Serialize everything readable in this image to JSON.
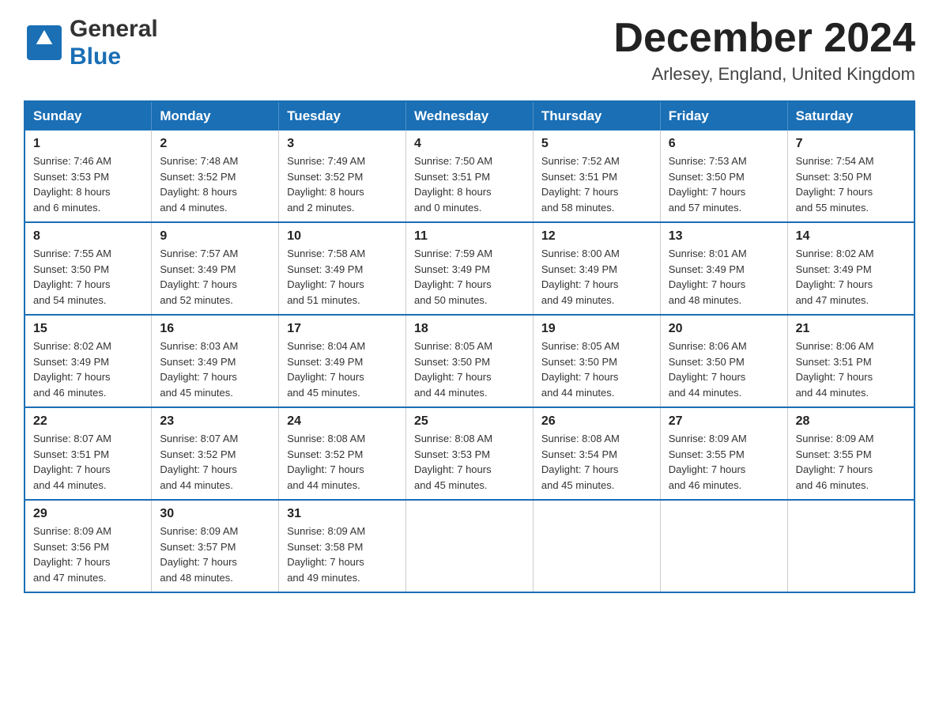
{
  "header": {
    "logo_general": "General",
    "logo_blue": "Blue",
    "title": "December 2024",
    "location": "Arlesey, England, United Kingdom"
  },
  "columns": [
    "Sunday",
    "Monday",
    "Tuesday",
    "Wednesday",
    "Thursday",
    "Friday",
    "Saturday"
  ],
  "weeks": [
    [
      {
        "day": "1",
        "sunrise": "7:46 AM",
        "sunset": "3:53 PM",
        "daylight": "8 hours",
        "minutes": "and 6 minutes."
      },
      {
        "day": "2",
        "sunrise": "7:48 AM",
        "sunset": "3:52 PM",
        "daylight": "8 hours",
        "minutes": "and 4 minutes."
      },
      {
        "day": "3",
        "sunrise": "7:49 AM",
        "sunset": "3:52 PM",
        "daylight": "8 hours",
        "minutes": "and 2 minutes."
      },
      {
        "day": "4",
        "sunrise": "7:50 AM",
        "sunset": "3:51 PM",
        "daylight": "8 hours",
        "minutes": "and 0 minutes."
      },
      {
        "day": "5",
        "sunrise": "7:52 AM",
        "sunset": "3:51 PM",
        "daylight": "7 hours",
        "minutes": "and 58 minutes."
      },
      {
        "day": "6",
        "sunrise": "7:53 AM",
        "sunset": "3:50 PM",
        "daylight": "7 hours",
        "minutes": "and 57 minutes."
      },
      {
        "day": "7",
        "sunrise": "7:54 AM",
        "sunset": "3:50 PM",
        "daylight": "7 hours",
        "minutes": "and 55 minutes."
      }
    ],
    [
      {
        "day": "8",
        "sunrise": "7:55 AM",
        "sunset": "3:50 PM",
        "daylight": "7 hours",
        "minutes": "and 54 minutes."
      },
      {
        "day": "9",
        "sunrise": "7:57 AM",
        "sunset": "3:49 PM",
        "daylight": "7 hours",
        "minutes": "and 52 minutes."
      },
      {
        "day": "10",
        "sunrise": "7:58 AM",
        "sunset": "3:49 PM",
        "daylight": "7 hours",
        "minutes": "and 51 minutes."
      },
      {
        "day": "11",
        "sunrise": "7:59 AM",
        "sunset": "3:49 PM",
        "daylight": "7 hours",
        "minutes": "and 50 minutes."
      },
      {
        "day": "12",
        "sunrise": "8:00 AM",
        "sunset": "3:49 PM",
        "daylight": "7 hours",
        "minutes": "and 49 minutes."
      },
      {
        "day": "13",
        "sunrise": "8:01 AM",
        "sunset": "3:49 PM",
        "daylight": "7 hours",
        "minutes": "and 48 minutes."
      },
      {
        "day": "14",
        "sunrise": "8:02 AM",
        "sunset": "3:49 PM",
        "daylight": "7 hours",
        "minutes": "and 47 minutes."
      }
    ],
    [
      {
        "day": "15",
        "sunrise": "8:02 AM",
        "sunset": "3:49 PM",
        "daylight": "7 hours",
        "minutes": "and 46 minutes."
      },
      {
        "day": "16",
        "sunrise": "8:03 AM",
        "sunset": "3:49 PM",
        "daylight": "7 hours",
        "minutes": "and 45 minutes."
      },
      {
        "day": "17",
        "sunrise": "8:04 AM",
        "sunset": "3:49 PM",
        "daylight": "7 hours",
        "minutes": "and 45 minutes."
      },
      {
        "day": "18",
        "sunrise": "8:05 AM",
        "sunset": "3:50 PM",
        "daylight": "7 hours",
        "minutes": "and 44 minutes."
      },
      {
        "day": "19",
        "sunrise": "8:05 AM",
        "sunset": "3:50 PM",
        "daylight": "7 hours",
        "minutes": "and 44 minutes."
      },
      {
        "day": "20",
        "sunrise": "8:06 AM",
        "sunset": "3:50 PM",
        "daylight": "7 hours",
        "minutes": "and 44 minutes."
      },
      {
        "day": "21",
        "sunrise": "8:06 AM",
        "sunset": "3:51 PM",
        "daylight": "7 hours",
        "minutes": "and 44 minutes."
      }
    ],
    [
      {
        "day": "22",
        "sunrise": "8:07 AM",
        "sunset": "3:51 PM",
        "daylight": "7 hours",
        "minutes": "and 44 minutes."
      },
      {
        "day": "23",
        "sunrise": "8:07 AM",
        "sunset": "3:52 PM",
        "daylight": "7 hours",
        "minutes": "and 44 minutes."
      },
      {
        "day": "24",
        "sunrise": "8:08 AM",
        "sunset": "3:52 PM",
        "daylight": "7 hours",
        "minutes": "and 44 minutes."
      },
      {
        "day": "25",
        "sunrise": "8:08 AM",
        "sunset": "3:53 PM",
        "daylight": "7 hours",
        "minutes": "and 45 minutes."
      },
      {
        "day": "26",
        "sunrise": "8:08 AM",
        "sunset": "3:54 PM",
        "daylight": "7 hours",
        "minutes": "and 45 minutes."
      },
      {
        "day": "27",
        "sunrise": "8:09 AM",
        "sunset": "3:55 PM",
        "daylight": "7 hours",
        "minutes": "and 46 minutes."
      },
      {
        "day": "28",
        "sunrise": "8:09 AM",
        "sunset": "3:55 PM",
        "daylight": "7 hours",
        "minutes": "and 46 minutes."
      }
    ],
    [
      {
        "day": "29",
        "sunrise": "8:09 AM",
        "sunset": "3:56 PM",
        "daylight": "7 hours",
        "minutes": "and 47 minutes."
      },
      {
        "day": "30",
        "sunrise": "8:09 AM",
        "sunset": "3:57 PM",
        "daylight": "7 hours",
        "minutes": "and 48 minutes."
      },
      {
        "day": "31",
        "sunrise": "8:09 AM",
        "sunset": "3:58 PM",
        "daylight": "7 hours",
        "minutes": "and 49 minutes."
      },
      null,
      null,
      null,
      null
    ]
  ],
  "labels": {
    "sunrise": "Sunrise:",
    "sunset": "Sunset:",
    "daylight": "Daylight:"
  }
}
